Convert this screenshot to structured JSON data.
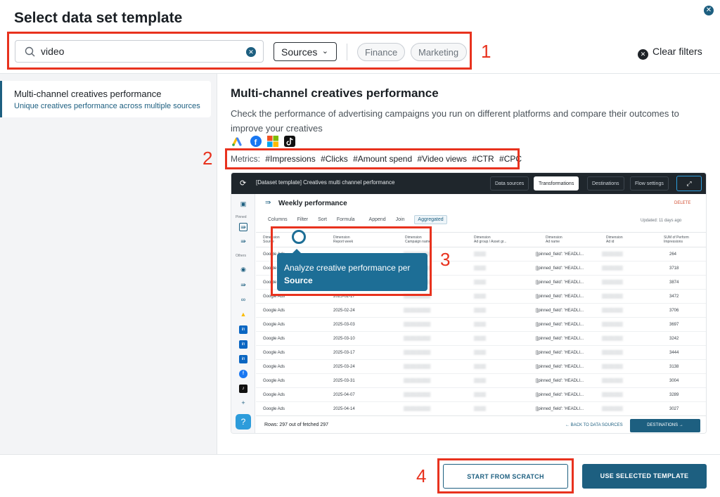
{
  "dialog": {
    "title": "Select data set template"
  },
  "search": {
    "value": "video"
  },
  "filters": {
    "sources_label": "Sources",
    "chips": [
      "Finance",
      "Marketing"
    ],
    "clear_label": "Clear filters"
  },
  "templates": [
    {
      "title": "Multi-channel creatives performance",
      "subtitle": "Unique creatives performance across multiple sources"
    }
  ],
  "detail": {
    "title": "Multi-channel creatives performance",
    "description": "Check the performance of advertising campaigns you run on different platforms and compare their outcomes to improve your creatives",
    "source_icons": [
      "google-ads-icon",
      "facebook-icon",
      "microsoft-icon",
      "tiktok-icon"
    ],
    "metrics_label": "Metrics:",
    "metrics": [
      "#Impressions",
      "#Clicks",
      "#Amount spend",
      "#Video views",
      "#CTR",
      "#CPC"
    ]
  },
  "preview": {
    "title": "[Dataset template] Creatives multi channel performance",
    "tabs": [
      "Data sources",
      "Transformations",
      "Destinations",
      "Flow settings"
    ],
    "active_tab": "Transformations",
    "sheet_title": "Weekly performance",
    "delete_label": "DELETE",
    "toolbar": [
      "Columns",
      "Filter",
      "Sort",
      "Formula",
      "Append",
      "Join",
      "Aggregated"
    ],
    "updated": "Updated: 11 days ago",
    "sidebar_labels": [
      "Pinned",
      "Others"
    ],
    "columns": [
      {
        "type": "ab",
        "l1": "Dimension",
        "l2": "Source"
      },
      {
        "type": "ab",
        "l1": "Dimension",
        "l2": "Report week"
      },
      {
        "type": "ab",
        "l1": "Dimension",
        "l2": "Campaign name"
      },
      {
        "type": "ab",
        "l1": "Dimension",
        "l2": "Ad group / Asset gr..."
      },
      {
        "type": "ab",
        "l1": "Dimension",
        "l2": "Ad name"
      },
      {
        "type": "ab",
        "l1": "Dimension",
        "l2": "Ad id"
      },
      {
        "type": "#",
        "l1": "SUM of Perform",
        "l2": "Impressions"
      }
    ],
    "rows": [
      {
        "source": "Google Ads",
        "week": "",
        "ad": "[[pinned_field': 'HEADLI...",
        "impr": "264"
      },
      {
        "source": "Google Ads",
        "week": "",
        "ad": "[[pinned_field': 'HEADLI...",
        "impr": "3718"
      },
      {
        "source": "Google Ads",
        "week": "",
        "ad": "[[pinned_field': 'HEADLI...",
        "impr": "3874"
      },
      {
        "source": "Google Ads",
        "week": "2025-02-17",
        "ad": "[[pinned_field': 'HEADLI...",
        "impr": "3472"
      },
      {
        "source": "Google Ads",
        "week": "2025-02-24",
        "ad": "[[pinned_field': 'HEADLI...",
        "impr": "3706"
      },
      {
        "source": "Google Ads",
        "week": "2025-03-03",
        "ad": "[[pinned_field': 'HEADLI...",
        "impr": "3697"
      },
      {
        "source": "Google Ads",
        "week": "2025-03-10",
        "ad": "[[pinned_field': 'HEADLI...",
        "impr": "3242"
      },
      {
        "source": "Google Ads",
        "week": "2025-03-17",
        "ad": "[[pinned_field': 'HEADLI...",
        "impr": "3444"
      },
      {
        "source": "Google Ads",
        "week": "2025-03-24",
        "ad": "[[pinned_field': 'HEADLI...",
        "impr": "3138"
      },
      {
        "source": "Google Ads",
        "week": "2025-03-31",
        "ad": "[[pinned_field': 'HEADLI...",
        "impr": "3004"
      },
      {
        "source": "Google Ads",
        "week": "2025-04-07",
        "ad": "[[pinned_field': 'HEADLI...",
        "impr": "3289"
      },
      {
        "source": "Google Ads",
        "week": "2025-04-14",
        "ad": "[[pinned_field': 'HEADLI...",
        "impr": "3027"
      }
    ],
    "rows_info": "Rows: 297 out of fetched 297",
    "back_label": "← BACK TO DATA SOURCES",
    "destinations_label": "DESTINATIONS →"
  },
  "tooltip": {
    "text": "Analyze creative performance per",
    "emphasis": "Source"
  },
  "annotations": [
    "1",
    "2",
    "3",
    "4"
  ],
  "footer": {
    "scratch_label": "START FROM SCRATCH",
    "use_label": "USE SELECTED TEMPLATE"
  },
  "colors": {
    "accent": "#1d5f80",
    "annotation": "#e8321e",
    "tooltip": "#1d6e96"
  }
}
